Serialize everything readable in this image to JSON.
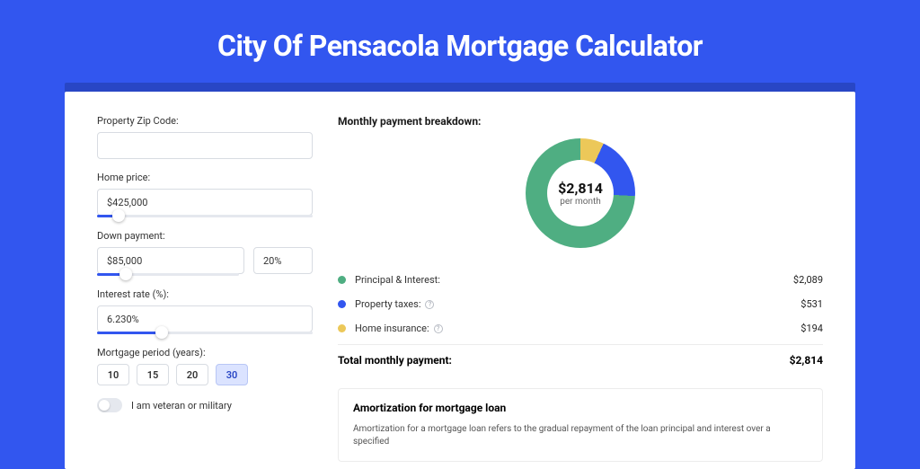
{
  "page_title": "City Of Pensacola Mortgage Calculator",
  "left": {
    "zip_label": "Property Zip Code:",
    "zip_value": "",
    "home_price_label": "Home price:",
    "home_price_value": "$425,000",
    "home_price_slider_pct": 10,
    "down_payment_label": "Down payment:",
    "down_payment_value": "$85,000",
    "down_payment_pct_value": "20%",
    "down_payment_slider_pct": 20,
    "interest_label": "Interest rate (%):",
    "interest_value": "6.230%",
    "interest_slider_pct": 30,
    "period_label": "Mortgage period (years):",
    "periods": [
      "10",
      "15",
      "20",
      "30"
    ],
    "period_active": "30",
    "veteran_label": "I am veteran or military"
  },
  "right": {
    "breakdown_title": "Monthly payment breakdown:",
    "center_amount": "$2,814",
    "center_sub": "per month",
    "items": [
      {
        "color": "#4fae82",
        "label": "Principal & Interest:",
        "value": "$2,089",
        "info": false
      },
      {
        "color": "#3256ef",
        "label": "Property taxes:",
        "value": "$531",
        "info": true
      },
      {
        "color": "#ecc859",
        "label": "Home insurance:",
        "value": "$194",
        "info": true
      }
    ],
    "total_label": "Total monthly payment:",
    "total_value": "$2,814",
    "amort_title": "Amortization for mortgage loan",
    "amort_text": "Amortization for a mortgage loan refers to the gradual repayment of the loan principal and interest over a specified"
  },
  "chart_data": {
    "type": "pie",
    "title": "Monthly payment breakdown",
    "series": [
      {
        "name": "Principal & Interest",
        "value": 2089,
        "color": "#4fae82"
      },
      {
        "name": "Property taxes",
        "value": 531,
        "color": "#3256ef"
      },
      {
        "name": "Home insurance",
        "value": 194,
        "color": "#ecc859"
      }
    ],
    "total": 2814,
    "unit": "USD per month"
  }
}
